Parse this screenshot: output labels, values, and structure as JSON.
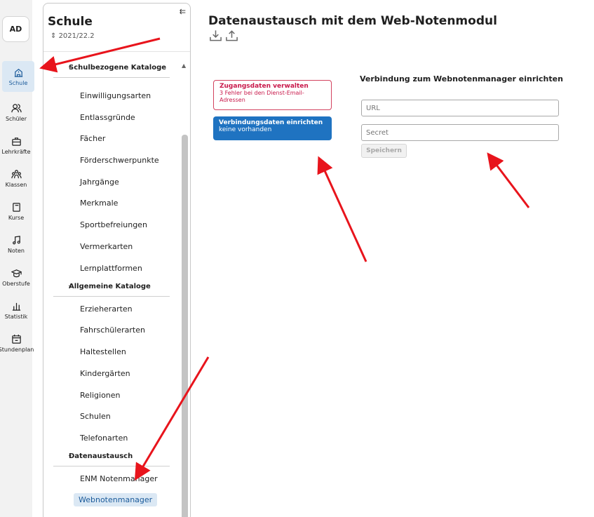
{
  "rail": {
    "avatar": "AD",
    "items": [
      {
        "label": "Schule"
      },
      {
        "label": "Schüler"
      },
      {
        "label": "Lehrkräfte"
      },
      {
        "label": "Klassen"
      },
      {
        "label": "Kurse"
      },
      {
        "label": "Noten"
      },
      {
        "label": "Oberstufe"
      },
      {
        "label": "Statistik"
      },
      {
        "label": "Stundenplan"
      }
    ]
  },
  "sidebar": {
    "title": "Schule",
    "year": "2021/22.2",
    "collapse_icon": "collapse-left-icon",
    "groups": [
      {
        "title": "Schulbezogene Kataloge",
        "items": [
          "Einwilligungsarten",
          "Entlassgründe",
          "Fächer",
          "Förderschwerpunkte",
          "Jahrgänge",
          "Merkmale",
          "Sportbefreiungen",
          "Vermerkarten",
          "Lernplattformen"
        ]
      },
      {
        "title": "Allgemeine Kataloge",
        "items": [
          "Erzieherarten",
          "Fahrschülerarten",
          "Haltestellen",
          "Kindergärten",
          "Religionen",
          "Schulen",
          "Telefonarten"
        ]
      },
      {
        "title": "Datenaustausch",
        "items": [
          "ENM Notenmanager",
          "Webnotenmanager"
        ]
      }
    ]
  },
  "main": {
    "title": "Datenaustausch mit dem Web-Notenmodul",
    "zugang": {
      "title": "Zugangsdaten verwalten",
      "subtitle": "3 Fehler bei den Dienst-Email-Adressen"
    },
    "verbindung": {
      "title": "Verbindungsdaten einrichten",
      "subtitle": "keine vorhanden"
    },
    "form": {
      "title": "Verbindung zum Webnotenmanager einrichten",
      "url_placeholder": "URL",
      "secret_placeholder": "Secret",
      "save_label": "Speichern"
    }
  },
  "colors": {
    "accent": "#1f73c1",
    "error": "#c8184a",
    "annotation_arrow": "#e8141c",
    "active_bg": "#dbe8f4"
  }
}
